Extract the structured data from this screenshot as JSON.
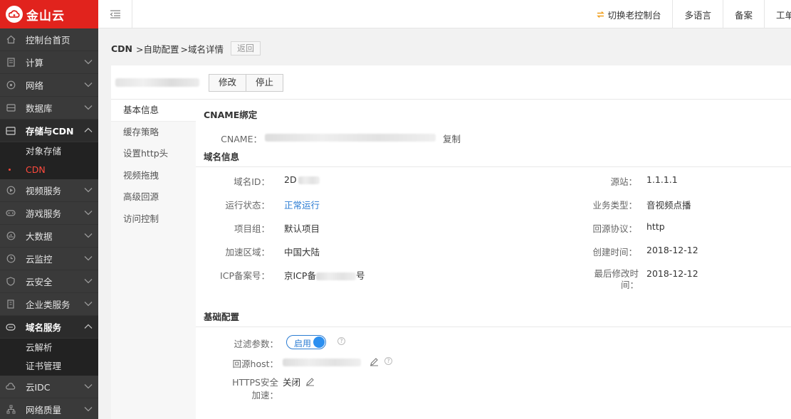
{
  "brand": {
    "name": "金山云"
  },
  "sidebar": {
    "items": [
      {
        "label": "控制台首页",
        "icon": "home-icon",
        "has_chevron": false
      },
      {
        "label": "计算",
        "icon": "server-icon",
        "has_chevron": true
      },
      {
        "label": "网络",
        "icon": "network-icon",
        "has_chevron": true
      },
      {
        "label": "数据库",
        "icon": "database-icon",
        "has_chevron": true
      },
      {
        "label": "存储与CDN",
        "icon": "storage-icon",
        "has_chevron": true,
        "expanded": true,
        "children": [
          {
            "label": "对象存储"
          },
          {
            "label": "CDN",
            "current": true
          }
        ]
      },
      {
        "label": "视频服务",
        "icon": "video-icon",
        "has_chevron": true
      },
      {
        "label": "游戏服务",
        "icon": "gamepad-icon",
        "has_chevron": true
      },
      {
        "label": "大数据",
        "icon": "bigdata-icon",
        "has_chevron": true
      },
      {
        "label": "云监控",
        "icon": "monitor-icon",
        "has_chevron": true
      },
      {
        "label": "云安全",
        "icon": "shield-icon",
        "has_chevron": true
      },
      {
        "label": "企业类服务",
        "icon": "building-icon",
        "has_chevron": true
      },
      {
        "label": "域名服务",
        "icon": "domain-icon",
        "has_chevron": true,
        "expanded": true,
        "children": [
          {
            "label": "云解析"
          },
          {
            "label": "证书管理"
          }
        ]
      },
      {
        "label": "云IDC",
        "icon": "idc-icon",
        "has_chevron": true
      },
      {
        "label": "网络质量",
        "icon": "topology-icon",
        "has_chevron": true
      }
    ]
  },
  "header": {
    "links": [
      {
        "label": "切换老控制台",
        "icon": "switch-arrows-icon"
      },
      {
        "label": "多语言"
      },
      {
        "label": "备案"
      },
      {
        "label": "工单"
      }
    ]
  },
  "breadcrumb": {
    "root": "CDN",
    "parts": [
      ">自助配置",
      ">域名详情"
    ],
    "back_label": "返回"
  },
  "toolbar": {
    "edit_label": "修改",
    "stop_label": "停止"
  },
  "subnav": [
    {
      "label": "基本信息",
      "active": true
    },
    {
      "label": "缓存策略"
    },
    {
      "label": "设置http头"
    },
    {
      "label": "视频拖拽"
    },
    {
      "label": "高级回源"
    },
    {
      "label": "访问控制"
    }
  ],
  "cname": {
    "section_title": "CNAME绑定",
    "label": "CNAME：",
    "copy_label": "复制"
  },
  "domain_info": {
    "section_title": "域名信息",
    "left": [
      {
        "label": "域名ID：",
        "value": "2D"
      },
      {
        "label": "运行状态：",
        "value": "正常运行",
        "link": true
      },
      {
        "label": "项目组：",
        "value": "默认项目"
      },
      {
        "label": "加速区域：",
        "value": "中国大陆"
      },
      {
        "label": "ICP备案号：",
        "value": "京ICP备",
        "suffix": "号"
      }
    ],
    "right": [
      {
        "label": "源站：",
        "value": "1.1.1.1"
      },
      {
        "label": "业务类型：",
        "value": "音视频点播"
      },
      {
        "label": "回源协议：",
        "value": "http"
      },
      {
        "label": "创建时间：",
        "value": "2018-12-12"
      },
      {
        "label": "最后修改时间：",
        "value": "2018-12-12"
      }
    ]
  },
  "basic_config": {
    "section_title": "基础配置",
    "filter_label": "过滤参数：",
    "filter_toggle_label": "启用",
    "host_label": "回源host：",
    "https_label": "HTTPS安全加速：",
    "https_value": "关闭"
  },
  "colors": {
    "brand_red": "#e1231d",
    "link_blue": "#2b7cd3",
    "sidebar_bg": "#3a3a3a"
  }
}
